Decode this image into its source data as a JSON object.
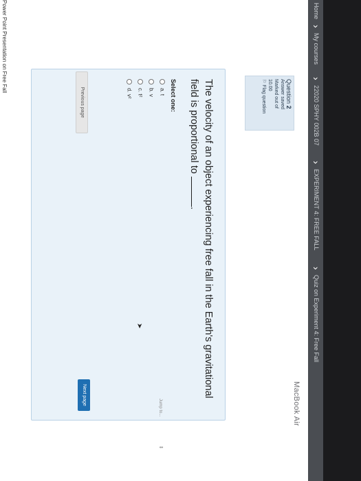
{
  "breadcrumb": {
    "items": [
      "Home",
      "My courses",
      "22020 SPHY 002B 07",
      "EXPERIMENT 4: FREE FALL",
      "Quiz on Experiment 4: Free Fall"
    ]
  },
  "question_info": {
    "label": "Question",
    "number": "2",
    "status": "Answer saved",
    "marked_out_of_label": "Marked out of",
    "marked_out_of": "10.00",
    "flag": "Flag question"
  },
  "question": {
    "text_before": "The velocity of an object experiencing free fall in the Earth's gravitational field is proportional to",
    "text_after": ".",
    "select_label": "Select one:",
    "options": [
      {
        "letter": "a.",
        "value": "t"
      },
      {
        "letter": "b.",
        "value": "v"
      },
      {
        "letter": "c.",
        "value": "t²"
      },
      {
        "letter": "d.",
        "value": "v²"
      }
    ]
  },
  "navigation": {
    "previous": "Previous page",
    "next": "Next page",
    "jump_to": "Jump to..."
  },
  "bottom_link": "Power Point Presentation on Free Fall",
  "device_brand": "MacBook Air",
  "colors": {
    "info_bg": "#dde8f2",
    "card_bg": "#e9f2f9",
    "next_button": "#1f6fb2",
    "breadcrumb_bar": "#4a4d52"
  }
}
